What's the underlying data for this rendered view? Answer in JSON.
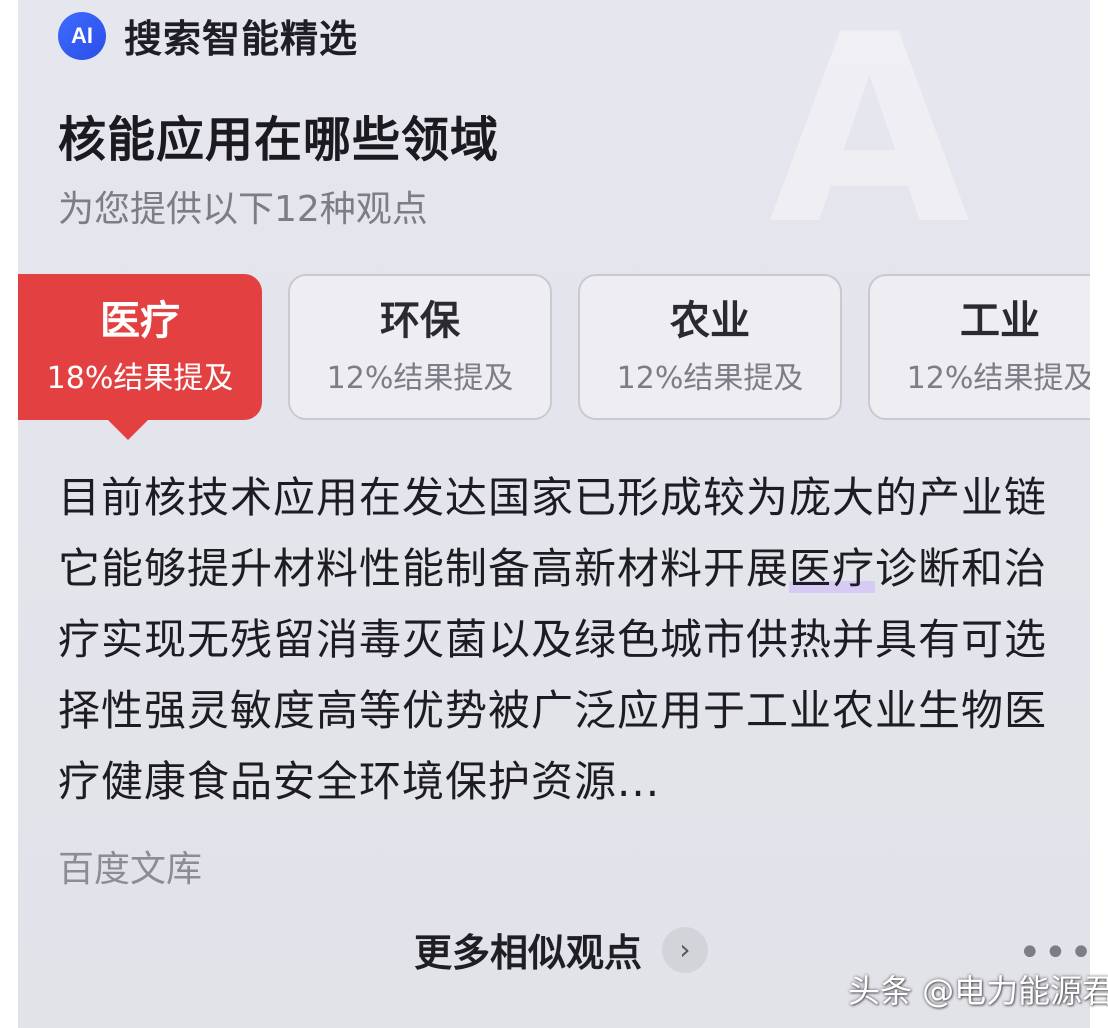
{
  "header": {
    "logo_text": "AI",
    "title": "搜索智能精选"
  },
  "question": "核能应用在哪些领域",
  "subtitle": "为您提供以下12种观点",
  "tabs": [
    {
      "name": "医疗",
      "pct": "18%结果提及",
      "active": true
    },
    {
      "name": "环保",
      "pct": "12%结果提及",
      "active": false
    },
    {
      "name": "农业",
      "pct": "12%结果提及",
      "active": false
    },
    {
      "name": "工业",
      "pct": "12%结果提及",
      "active": false
    }
  ],
  "content": {
    "before": "目前核技术应用在发达国家已形成较为庞大的产业链它能够提升材料性能制备高新材料开展",
    "highlight": "医疗",
    "after": "诊断和治疗实现无残留消毒灭菌以及绿色城市供热并具有可选择性强灵敏度高等优势被广泛应用于工业农业生物医疗健康食品安全环境保护资源..."
  },
  "source": "百度文库",
  "more": {
    "label": "更多相似观点",
    "icon": "›"
  },
  "menu_dots": "•••",
  "watermark": "头条 @电力能源君",
  "colors": {
    "accent": "#e34141",
    "logo": "#2f5bf5",
    "highlight": "#d6cbf5"
  }
}
